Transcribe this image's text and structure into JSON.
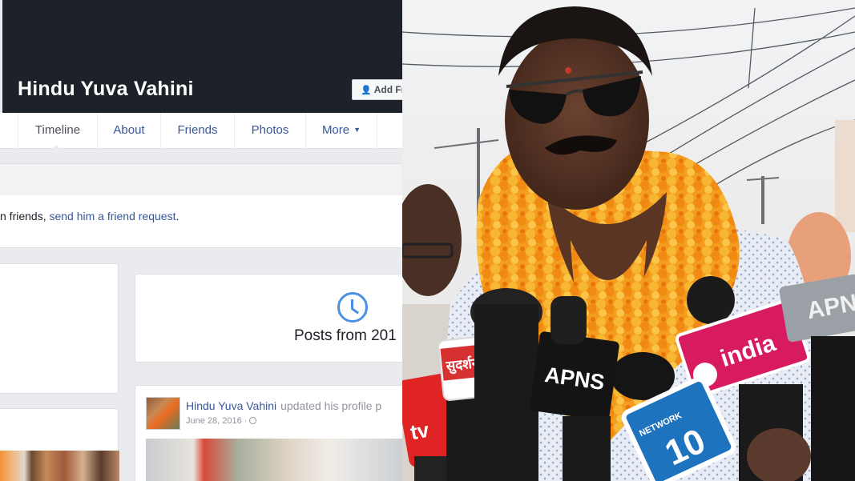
{
  "profile": {
    "page_name": "Hindu Yuva Vahini",
    "add_friend_label": "Add Fr"
  },
  "tabs": [
    {
      "label": "Timeline",
      "active": true
    },
    {
      "label": "About"
    },
    {
      "label": "Friends"
    },
    {
      "label": "Photos"
    },
    {
      "label": "More"
    }
  ],
  "friend_notice": {
    "prefix": "n friends, ",
    "link": "send him a friend request",
    "suffix": "."
  },
  "posts_card": {
    "label": "Posts from 201"
  },
  "post": {
    "author": "Hindu Yuva Vahini",
    "action": "updated his profile p",
    "date": "June 28, 2016 ·"
  },
  "photo": {
    "mic_labels": [
      "सुदर्शन",
      "APNS",
      "india",
      "NETWORK",
      "10",
      "APN"
    ]
  },
  "colors": {
    "facebook_blue": "#365899",
    "cover_dark": "#1d2129",
    "marigold": "#f5a623",
    "clock_blue": "#4a90e2"
  }
}
